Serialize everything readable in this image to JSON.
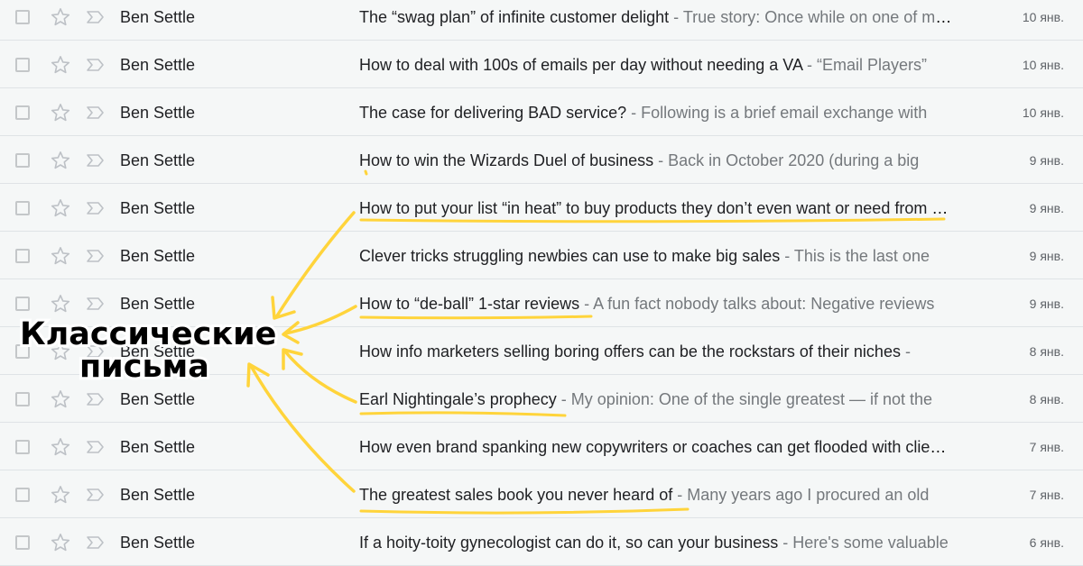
{
  "emails": [
    {
      "sender": "Ben Settle",
      "subject": "The “swag plan” of infinite customer delight",
      "snippet": "True story: Once while on one of my first trips",
      "date": "10 янв."
    },
    {
      "sender": "Ben Settle",
      "subject": "How to deal with 100s of emails per day without needing a VA",
      "snippet": "“Email Players”",
      "date": "10 янв."
    },
    {
      "sender": "Ben Settle",
      "subject": "The case for delivering BAD service?",
      "snippet": "Following is a brief email exchange with",
      "date": "10 янв."
    },
    {
      "sender": "Ben Settle",
      "subject": "How to win the Wizards Duel of business",
      "snippet": "Back in October 2020 (during a big",
      "date": "9 янв."
    },
    {
      "sender": "Ben Settle",
      "subject": "How to put your list “in heat” to buy products they don’t even want or need from you",
      "snippet": "",
      "date": "9 янв."
    },
    {
      "sender": "Ben Settle",
      "subject": "Clever tricks struggling newbies can use to make big sales",
      "snippet": "This is the last one",
      "date": "9 янв."
    },
    {
      "sender": "Ben Settle",
      "subject": "How to “de-ball” 1-star reviews",
      "snippet": "A fun fact nobody talks about: Negative reviews",
      "date": "9 янв."
    },
    {
      "sender": "Ben Settle",
      "subject": "How info marketers selling boring offers can be the rockstars of their niches",
      "snippet": "",
      "date": "8 янв."
    },
    {
      "sender": "Ben Settle",
      "subject": "Earl Nightingale’s prophecy",
      "snippet": "My opinion: One of the single greatest — if not the",
      "date": "8 янв."
    },
    {
      "sender": "Ben Settle",
      "subject": "How even brand spanking new copywriters or coaches can get flooded with clients",
      "snippet": "",
      "date": "7 янв."
    },
    {
      "sender": "Ben Settle",
      "subject": "The greatest sales book you never heard of",
      "snippet": "Many years ago I procured an old",
      "date": "7 янв."
    },
    {
      "sender": "Ben Settle",
      "subject": "If a hoity-toity gynecologist can do it, so can your business",
      "snippet": "Here's some valuable",
      "date": "6 янв."
    }
  ],
  "annotation": {
    "line1": "Классические",
    "line2": "письма",
    "color": "#ffd43b"
  },
  "icons": {
    "checkbox": "checkbox-icon",
    "star": "star-icon",
    "important": "important-marker-icon"
  },
  "colors": {
    "row_bg": "#f5f7f7",
    "text": "#202124",
    "snippet": "#74787c",
    "divider": "#dfe3e6"
  }
}
